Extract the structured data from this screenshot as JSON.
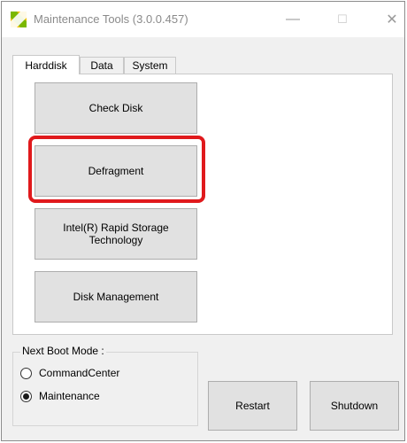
{
  "window": {
    "title": "Maintenance Tools (3.0.0.457)",
    "minimize_glyph": "—",
    "maximize_glyph": "☐",
    "close_glyph": "✕"
  },
  "tabs": [
    {
      "label": "Harddisk",
      "active": true
    },
    {
      "label": "Data",
      "active": false
    },
    {
      "label": "System",
      "active": false
    }
  ],
  "harddisk": {
    "buttons": [
      {
        "label": "Check Disk"
      },
      {
        "label": "Defragment"
      },
      {
        "label": "Intel(R) Rapid Storage\nTechnology"
      },
      {
        "label": "Disk Management"
      }
    ],
    "highlighted_button": "Defragment"
  },
  "boot_mode": {
    "legend": "Next Boot Mode :",
    "options": [
      {
        "label": "CommandCenter",
        "checked": false
      },
      {
        "label": "Maintenance",
        "checked": true
      }
    ]
  },
  "actions": {
    "restart_label": "Restart",
    "shutdown_label": "Shutdown"
  },
  "colors": {
    "highlight": "#e0191c",
    "icon_yellow": "#f5c000",
    "icon_green": "#7ab800"
  },
  "icons": {
    "app": "app-logo-icon"
  }
}
